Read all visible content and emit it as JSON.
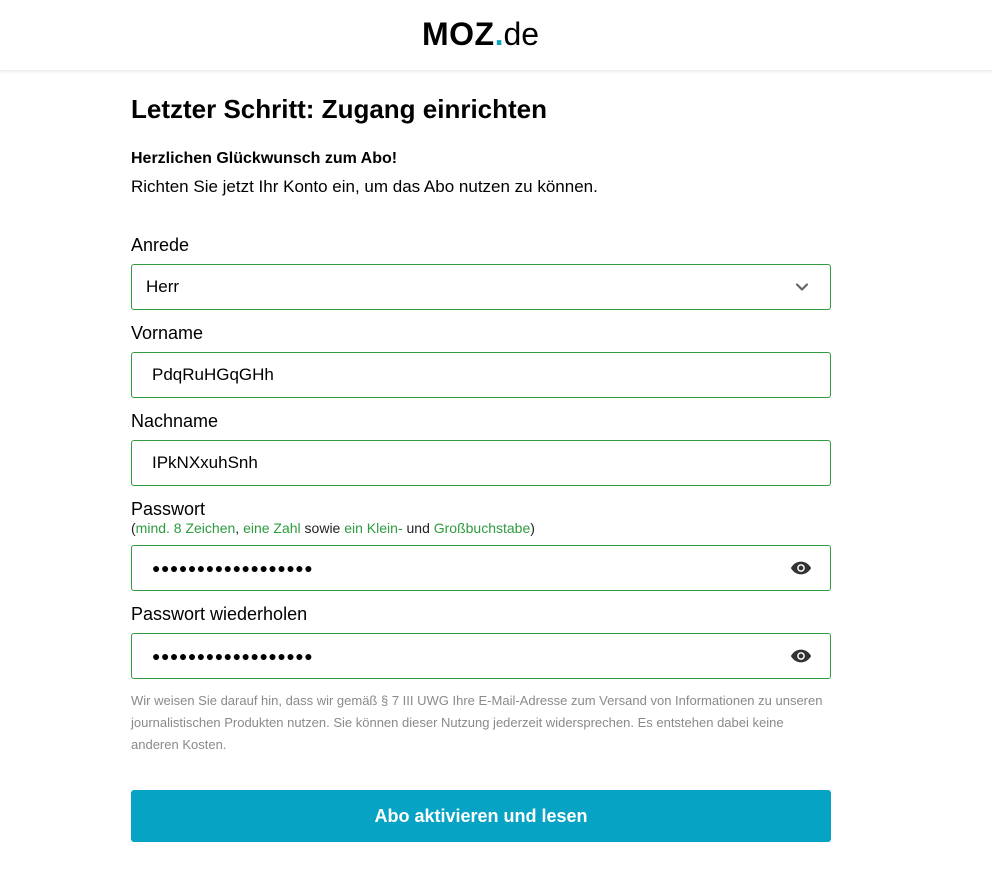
{
  "header": {
    "logo_main": "MOZ",
    "logo_dot": ".",
    "logo_tld": "de",
    "brand_color": "#0aa3c2"
  },
  "page": {
    "title": "Letzter Schritt: Zugang einrichten",
    "intro_strong": "Herzlichen Glückwunsch zum Abo!",
    "intro_text": "Richten Sie jetzt Ihr Konto ein, um das Abo nutzen zu können."
  },
  "form": {
    "salutation": {
      "label": "Anrede",
      "value": "Herr",
      "icon": "chevron-down-icon"
    },
    "first_name": {
      "label": "Vorname",
      "value": "PdqRuHGqGHh"
    },
    "last_name": {
      "label": "Nachname",
      "value": "IPkNXxuhSnh"
    },
    "password": {
      "label": "Passwort",
      "hint": {
        "open": "(",
        "req1": "mind. 8 Zeichen",
        "sep1": ", ",
        "req2": "eine Zahl",
        "sep2": " sowie ",
        "req3": "ein Klein-",
        "sep3": " und ",
        "req4": "Großbuchstabe",
        "close": ")"
      },
      "value": "●●●●●●●●●●●●●●●●●●",
      "icon": "eye-icon"
    },
    "password_repeat": {
      "label": "Passwort wiederholen",
      "value": "●●●●●●●●●●●●●●●●●●",
      "icon": "eye-icon"
    },
    "legal_text": "Wir weisen Sie darauf hin, dass wir gemäß § 7 III UWG Ihre E-Mail-Adresse zum Versand von Informationen zu unseren journalistischen Produkten nutzen. Sie können dieser Nutzung jederzeit widersprechen. Es entstehen dabei keine anderen Kosten.",
    "submit_label": "Abo aktivieren und lesen"
  },
  "colors": {
    "field_border": "#2e9b3f",
    "hint_green": "#2e9b3f",
    "button": "#06a3c4",
    "legal_text": "#8a8a8a"
  }
}
